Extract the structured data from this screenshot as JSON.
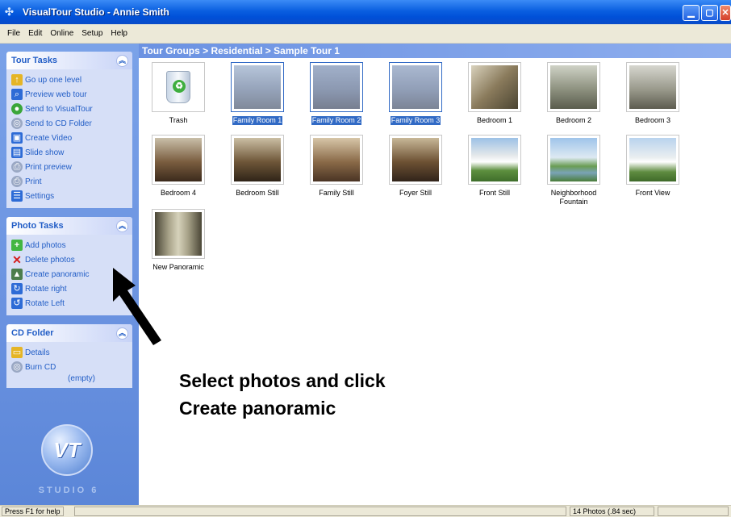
{
  "window": {
    "title": "VisualTour Studio - Annie Smith"
  },
  "menu": [
    "File",
    "Edit",
    "Online",
    "Setup",
    "Help"
  ],
  "tour_tasks": {
    "title": "Tour Tasks",
    "items": [
      "Go up one level",
      "Preview web tour",
      "Send to VisualTour",
      "Send to CD Folder",
      "Create Video",
      "Slide show",
      "Print preview",
      "Print",
      "Settings"
    ]
  },
  "photo_tasks": {
    "title": "Photo Tasks",
    "items": [
      "Add photos",
      "Delete photos",
      "Create panoramic",
      "Rotate right",
      "Rotate Left"
    ]
  },
  "cd_folder": {
    "title": "CD Folder",
    "items": [
      "Details",
      "Burn CD"
    ],
    "empty_note": "(empty)"
  },
  "logo": {
    "text": "STUDIO 6"
  },
  "breadcrumb": "Tour Groups > Residential > Sample Tour 1",
  "thumbnails": [
    {
      "label": "Trash"
    },
    {
      "label": "Family Room 1"
    },
    {
      "label": "Family Room 2"
    },
    {
      "label": "Family Room 3"
    },
    {
      "label": "Bedroom 1"
    },
    {
      "label": "Bedroom 2"
    },
    {
      "label": "Bedroom 3"
    },
    {
      "label": "Bedroom 4"
    },
    {
      "label": "Bedroom Still"
    },
    {
      "label": "Family Still"
    },
    {
      "label": "Foyer Still"
    },
    {
      "label": "Front Still"
    },
    {
      "label": "Neighborhood Fountain"
    },
    {
      "label": "Front View"
    },
    {
      "label": "New Panoramic"
    }
  ],
  "hint": {
    "line1": "Select photos and click",
    "line2": "Create panoramic"
  },
  "status": {
    "help": "Press F1 for help",
    "count": "14 Photos (.84 sec)"
  },
  "colors": {
    "accent": "#215dc6",
    "selection": "#316ac5",
    "pane": "#6a92e0"
  }
}
